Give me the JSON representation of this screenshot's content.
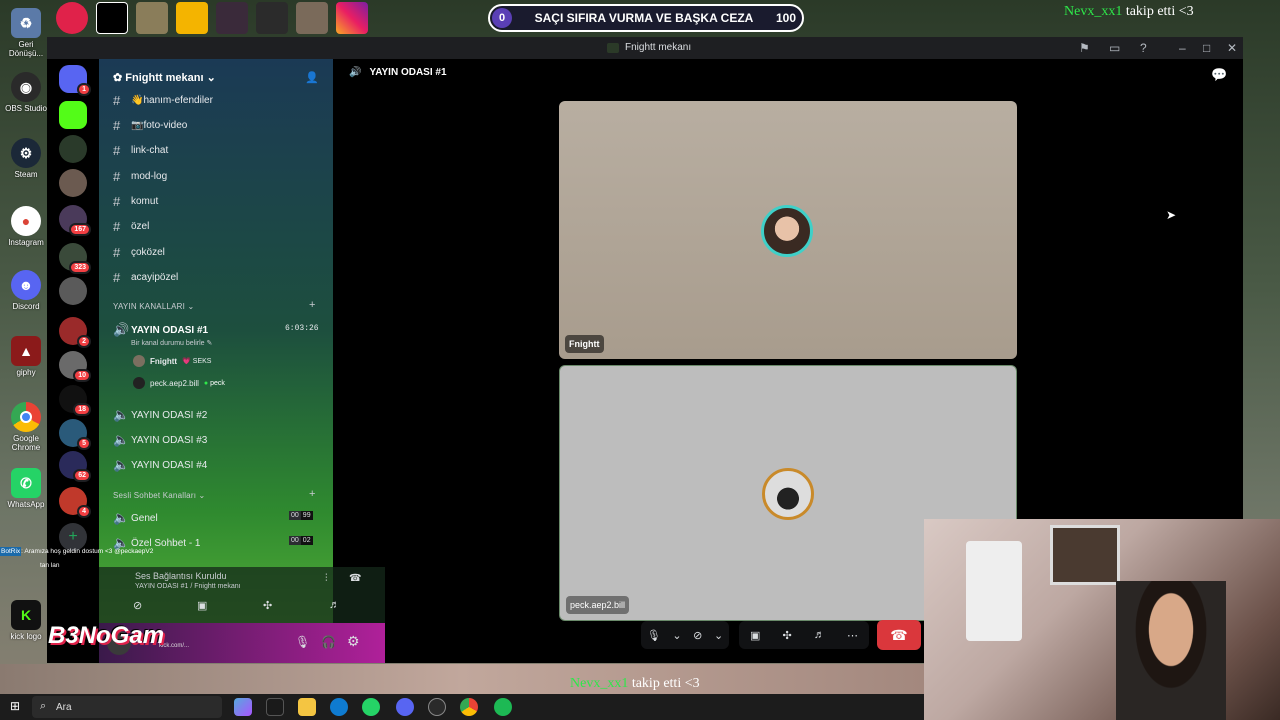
{
  "desktop": {
    "icons": [
      {
        "label": "Geri Dönüşü...",
        "icon": "recycle-bin-icon"
      },
      {
        "label": "OBS Studio",
        "icon": "obs-icon"
      },
      {
        "label": "Steam",
        "icon": "steam-icon"
      },
      {
        "label": "Instagram",
        "icon": "instagram-icon"
      },
      {
        "label": "Discord",
        "icon": "discord-icon"
      },
      {
        "label": "giphy",
        "icon": "giphy-icon"
      },
      {
        "label": "Google Chrome",
        "icon": "chrome-icon"
      },
      {
        "label": "WhatsApp",
        "icon": "whatsapp-icon"
      },
      {
        "label": "kick logo",
        "icon": "kick-icon"
      }
    ]
  },
  "overlay": {
    "score_left": "0",
    "score_title": "SAÇI SIFIRA VURMA VE BAŞKA CEZA",
    "score_right": "100",
    "follow_user": "Nevx_xx1",
    "follow_text": "takip etti <3",
    "logo_text": "B3NoGam",
    "chat_user": "BotRix",
    "chat_msg": ": Aramıza hoş geldin dostum <3 @peckaepV2",
    "chat_line2": "tan lan"
  },
  "window": {
    "title": "Fnightt mekanı"
  },
  "guilds": {
    "dm_badge": "1",
    "badges": [
      "167",
      "323",
      "2",
      "10",
      "18",
      "5",
      "62",
      "4"
    ]
  },
  "server": {
    "name": "Fnightt mekanı",
    "text_channels": [
      "👋hanım-efendiler",
      "📷foto-video",
      "link-chat",
      "mod-log",
      "komut",
      "özel",
      "çoközel",
      "acayipözel"
    ],
    "category_stream": "YAYIN KANALLARI",
    "active_channel": "YAYIN ODASI #1",
    "active_timer": "6:03:26",
    "active_status": "Bir kanal durumu belirle",
    "voice_users": [
      {
        "name": "Fnightt",
        "tag": "💗 SEKS"
      },
      {
        "name": "peck.aep2.bill",
        "tag": "peck"
      }
    ],
    "stream_channels": [
      "YAYIN ODASI #2",
      "YAYIN ODASI #3",
      "YAYIN ODASI #4"
    ],
    "category_voice": "Sesli Sohbet Kanalları",
    "voice_channels": [
      {
        "name": "Genel",
        "count": "00",
        "limit": "99"
      },
      {
        "name": "Özel Sohbet - 1",
        "count": "00",
        "limit": "02"
      }
    ]
  },
  "voice_panel": {
    "status": "Ses Bağlantısı Kuruldu",
    "location": "YAYIN ODASI #1 / Fnightt mekanı"
  },
  "user_panel": {
    "subtitle": "kick.com/..."
  },
  "stage": {
    "channel_title": "YAYIN ODASI #1",
    "tiles": [
      {
        "name": "Fnightt"
      },
      {
        "name": "peck.aep2.bill"
      }
    ]
  },
  "taskbar": {
    "search_placeholder": "Ara"
  },
  "colors": {
    "accent_green": "#2ee84a",
    "hangup_red": "#da373c",
    "notif_red": "#f23f43",
    "speaking_ring": "#3fd0c8"
  }
}
